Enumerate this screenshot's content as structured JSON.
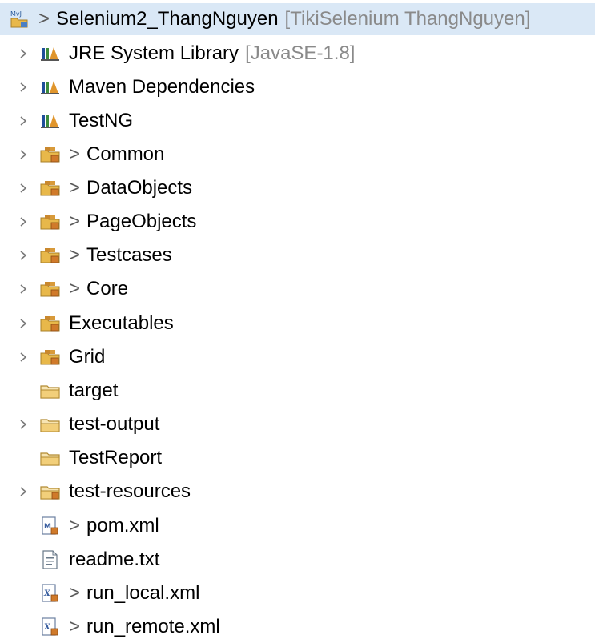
{
  "project": {
    "name": "Selenium2_ThangNguyen",
    "decoration": "[TikiSelenium ThangNguyen]",
    "dirty_marker": ">"
  },
  "items": [
    {
      "label": "JRE System Library",
      "decoration": "[JavaSE-1.8]",
      "prefix": "",
      "icon": "library-icon",
      "expandable": true
    },
    {
      "label": "Maven Dependencies",
      "decoration": "",
      "prefix": "",
      "icon": "library-icon",
      "expandable": true
    },
    {
      "label": "TestNG",
      "decoration": "",
      "prefix": "",
      "icon": "library-icon",
      "expandable": true
    },
    {
      "label": "Common",
      "decoration": "",
      "prefix": ">",
      "icon": "package-folder-icon",
      "expandable": true
    },
    {
      "label": "DataObjects",
      "decoration": "",
      "prefix": ">",
      "icon": "package-folder-icon",
      "expandable": true
    },
    {
      "label": "PageObjects",
      "decoration": "",
      "prefix": ">",
      "icon": "package-folder-icon",
      "expandable": true
    },
    {
      "label": "Testcases",
      "decoration": "",
      "prefix": ">",
      "icon": "package-folder-icon",
      "expandable": true
    },
    {
      "label": "Core",
      "decoration": "",
      "prefix": ">",
      "icon": "package-folder-icon",
      "expandable": true
    },
    {
      "label": "Executables",
      "decoration": "",
      "prefix": "",
      "icon": "package-folder-icon",
      "expandable": true
    },
    {
      "label": "Grid",
      "decoration": "",
      "prefix": "",
      "icon": "package-folder-icon",
      "expandable": true
    },
    {
      "label": "target",
      "decoration": "",
      "prefix": "",
      "icon": "folder-icon",
      "expandable": false
    },
    {
      "label": "test-output",
      "decoration": "",
      "prefix": "",
      "icon": "folder-icon",
      "expandable": true
    },
    {
      "label": "TestReport",
      "decoration": "",
      "prefix": "",
      "icon": "folder-icon",
      "expandable": false
    },
    {
      "label": "test-resources",
      "decoration": "",
      "prefix": "",
      "icon": "source-folder-icon",
      "expandable": true
    },
    {
      "label": "pom.xml",
      "decoration": "",
      "prefix": ">",
      "icon": "maven-pom-icon",
      "expandable": false
    },
    {
      "label": "readme.txt",
      "decoration": "",
      "prefix": "",
      "icon": "text-file-icon",
      "expandable": false
    },
    {
      "label": "run_local.xml",
      "decoration": "",
      "prefix": ">",
      "icon": "xml-file-icon",
      "expandable": false
    },
    {
      "label": "run_remote.xml",
      "decoration": "",
      "prefix": ">",
      "icon": "xml-file-icon",
      "expandable": false
    }
  ],
  "colors": {
    "selection": "#dae8f6",
    "decoration": "#8a8a8a",
    "folder": "#e8b84a",
    "library_blue": "#1f4e9a",
    "library_green": "#3c8c3c",
    "library_orange": "#e0952c"
  }
}
